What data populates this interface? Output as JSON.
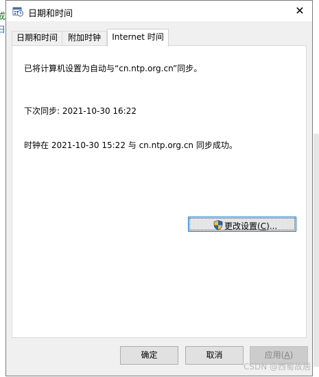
{
  "window": {
    "title": "日期和时间",
    "close_glyph": "✕"
  },
  "background": {
    "glyph1": "或",
    "glyph2": "日"
  },
  "tabs": [
    {
      "label": "日期和时间",
      "selected": false
    },
    {
      "label": "附加时钟",
      "selected": false
    },
    {
      "label": "Internet 时间",
      "selected": true
    }
  ],
  "panel": {
    "line1": "已将计算机设置为自动与“cn.ntp.org.cn”同步。",
    "line2": "下次同步: 2021-10-30 16:22",
    "line3": "时钟在 2021-10-30 15:22 与 cn.ntp.org.cn 同步成功。",
    "change_button": {
      "label_prefix": "更改设置(",
      "mnemonic": "C",
      "label_suffix": ")..."
    }
  },
  "footer": {
    "ok": "确定",
    "cancel": "取消",
    "apply_prefix": "应用(",
    "apply_mnemonic": "A",
    "apply_suffix": ")"
  },
  "watermark": "CSDN @西蜀故居",
  "colors": {
    "accent": "#0078d7",
    "shield_blue": "#2f5fb5",
    "shield_yellow": "#f4c430"
  },
  "icons": {
    "title": "clock-calendar-icon",
    "shield": "uac-shield-icon",
    "close": "close-icon"
  }
}
